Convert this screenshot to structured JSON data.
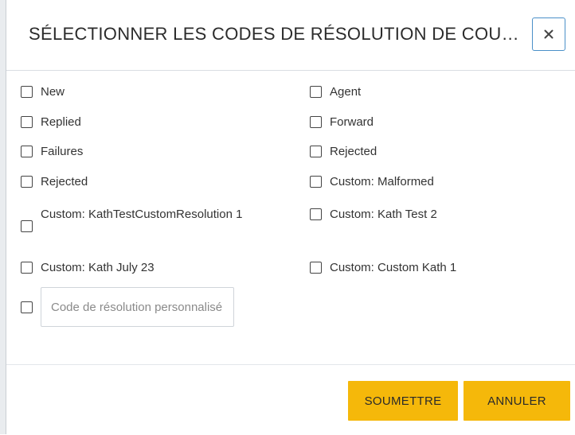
{
  "modal": {
    "title": "SÉLECTIONNER LES CODES DE RÉSOLUTION DE COURRIEL",
    "close_label": "×"
  },
  "options": {
    "left": [
      {
        "label": "New",
        "checked": false
      },
      {
        "label": "Replied",
        "checked": false
      },
      {
        "label": "Failures",
        "checked": false
      },
      {
        "label": "Rejected",
        "checked": false
      },
      {
        "label": "Custom: KathTestCustomResolution 1",
        "checked": false
      },
      {
        "label": "Custom: Kath July 23",
        "checked": false
      }
    ],
    "right": [
      {
        "label": "Agent",
        "checked": false
      },
      {
        "label": "Forward",
        "checked": false
      },
      {
        "label": "Rejected",
        "checked": false
      },
      {
        "label": "Custom: Malformed",
        "checked": false
      },
      {
        "label": "Custom: Kath Test 2",
        "checked": false
      },
      {
        "label": "Custom: Custom Kath 1",
        "checked": false
      }
    ]
  },
  "custom_code": {
    "placeholder": "Code de résolution personnalisé",
    "value": "",
    "checked": false
  },
  "footer": {
    "submit_label": "SOUMETTRE",
    "cancel_label": "ANNULER"
  },
  "colors": {
    "accent_button": "#f5b80a",
    "close_border": "#4a90c8"
  }
}
